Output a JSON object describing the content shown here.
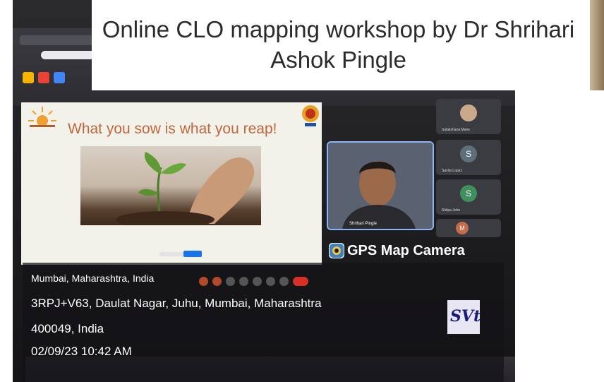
{
  "header": {
    "title": "Online CLO mapping workshop by Dr Shrihari Ashok Pingle"
  },
  "slide": {
    "title": "What you sow is what you reap!"
  },
  "meeting": {
    "presenter_name": "Shrihari Pingle",
    "participants": [
      {
        "name": "Sulakshana Mane",
        "initial": "",
        "color": "#c9a98a"
      },
      {
        "name": "Savita Lopez",
        "initial": "S",
        "color": "#5f6f7a"
      },
      {
        "name": "Shilpa John",
        "initial": "S",
        "color": "#3f8f5f"
      },
      {
        "name": "",
        "initial": "M",
        "color": "#c66a4a"
      }
    ]
  },
  "camera_overlay": {
    "app_name": "GPS Map Camera",
    "city": "Mumbai, Maharashtra, India",
    "address": "3RPJ+V63, Daulat Nagar, Juhu, Mumbai, Maharashtra",
    "postal": "400049, India",
    "datetime": "02/09/23 10:42 AM",
    "logo_text": "SVt"
  },
  "icons": {
    "gps": "map-pin-icon",
    "logo": "svt-logo-icon"
  },
  "colors": {
    "slide_title": "#c0683d",
    "presenter_border": "#8ab4f8",
    "meet_end_call": "#d93025"
  }
}
